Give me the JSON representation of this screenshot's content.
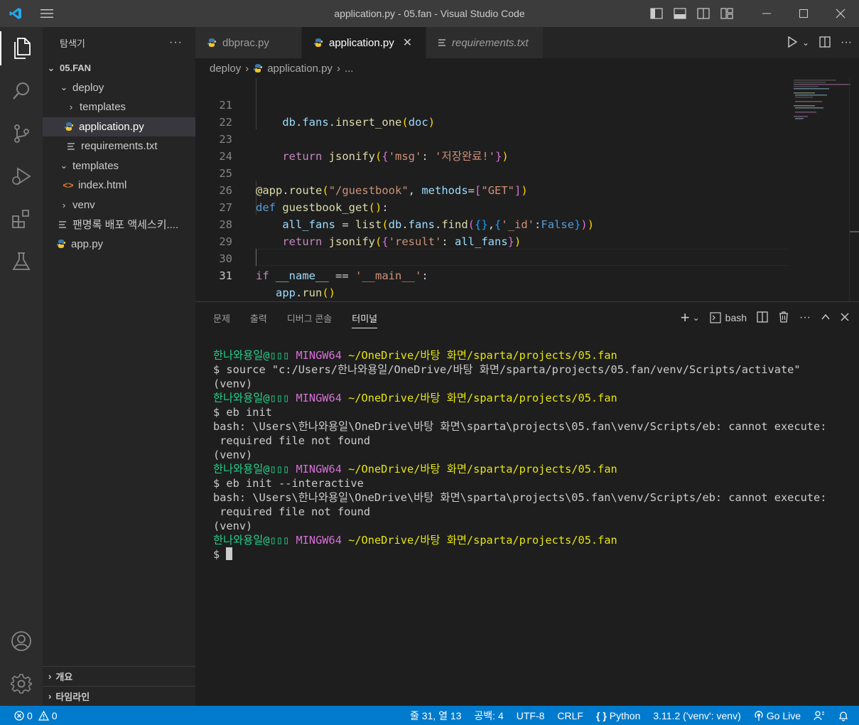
{
  "window": {
    "title": "application.py - 05.fan - Visual Studio Code"
  },
  "sidebar": {
    "header": "탐색기",
    "more": "···",
    "root": "05.FAN",
    "items": [
      {
        "label": "deploy",
        "type": "folder-open"
      },
      {
        "label": "templates",
        "type": "folder-closed"
      },
      {
        "label": "application.py",
        "type": "python"
      },
      {
        "label": "requirements.txt",
        "type": "text"
      },
      {
        "label": "templates",
        "type": "folder-open"
      },
      {
        "label": "index.html",
        "type": "html"
      },
      {
        "label": "venv",
        "type": "folder-closed"
      },
      {
        "label": "팬명록 배포 액세스키....",
        "type": "text"
      },
      {
        "label": "app.py",
        "type": "python"
      }
    ],
    "footer": {
      "outline": "개요",
      "timeline": "타임라인"
    }
  },
  "tabs": [
    {
      "label": "dbprac.py"
    },
    {
      "label": "application.py",
      "close": "✕"
    },
    {
      "label": "requirements.txt"
    }
  ],
  "breadcrumb": {
    "folder": "deploy",
    "file": "application.py",
    "more": "..."
  },
  "editor": {
    "line_numbers": [
      "21",
      "22",
      "23",
      "24",
      "25",
      "26",
      "27",
      "28",
      "29",
      "30",
      "31"
    ]
  },
  "panel": {
    "tabs": [
      "문제",
      "출력",
      "디버그 콘솔",
      "터미널"
    ],
    "shell": "bash"
  },
  "terminal": {
    "prompt_user": "한나와용일@▯▯▯",
    "prompt_host": "MINGW64",
    "prompt_path": "~/OneDrive/바탕 화면/sparta/projects/05.fan",
    "lines": [
      "$ source \"c:/Users/한나와용일/OneDrive/바탕 화면/sparta/projects/05.fan/venv/Scripts/activate\"",
      "(venv)",
      "$ eb init",
      "bash: \\Users\\한나와용일\\OneDrive\\바탕 화면\\sparta\\projects\\05.fan\\venv/Scripts/eb: cannot execute:",
      " required file not found",
      "(venv)",
      "$ eb init --interactive",
      "bash: \\Users\\한나와용일\\OneDrive\\바탕 화면\\sparta\\projects\\05.fan\\venv/Scripts/eb: cannot execute:",
      " required file not found",
      "(venv)",
      "$ "
    ]
  },
  "statusbar": {
    "errors": "0",
    "warnings": "0",
    "position": "줄 31, 열 13",
    "spaces": "공백: 4",
    "encoding": "UTF-8",
    "eol": "CRLF",
    "language": "Python",
    "interpreter": "3.11.2 ('venv': venv)",
    "golive": "Go Live"
  },
  "colors": {
    "accent": "#007acc",
    "activity_bar": "#2c2c2c",
    "sidebar": "#252526",
    "editor_bg": "#1e1e1e"
  }
}
